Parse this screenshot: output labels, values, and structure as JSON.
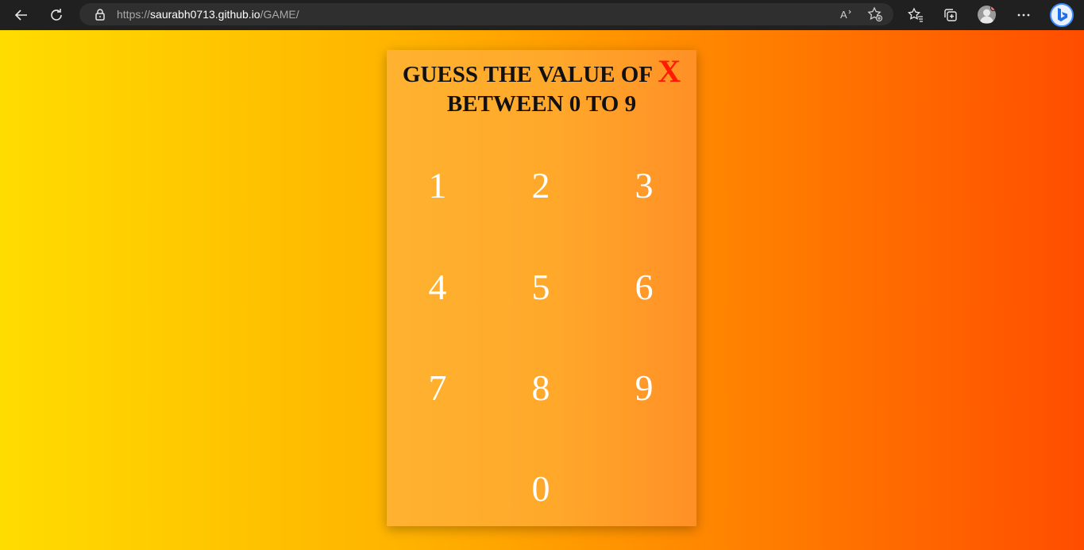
{
  "browser": {
    "url_prefix": "https://",
    "url_host": "saurabh0713.github.io",
    "url_path": "/GAME/",
    "icons": [
      "back-icon",
      "refresh-icon",
      "lock-icon",
      "read-aloud-icon",
      "add-favorite-icon",
      "favorites-icon",
      "collections-icon",
      "profile-avatar",
      "more-icon",
      "bing-icon"
    ]
  },
  "game": {
    "title_line1": "GUESS THE VALUE OF",
    "title_x": "X",
    "title_line2": "BETWEEN 0 TO 9",
    "keys": [
      "1",
      "2",
      "3",
      "4",
      "5",
      "6",
      "7",
      "8",
      "9",
      "0"
    ],
    "colors": {
      "gradient_start": "#ffdc00",
      "gradient_end": "#ff4d00",
      "card": "#ffa82a",
      "x_accent": "#ff1a00",
      "key_text": "#ffffff"
    }
  }
}
